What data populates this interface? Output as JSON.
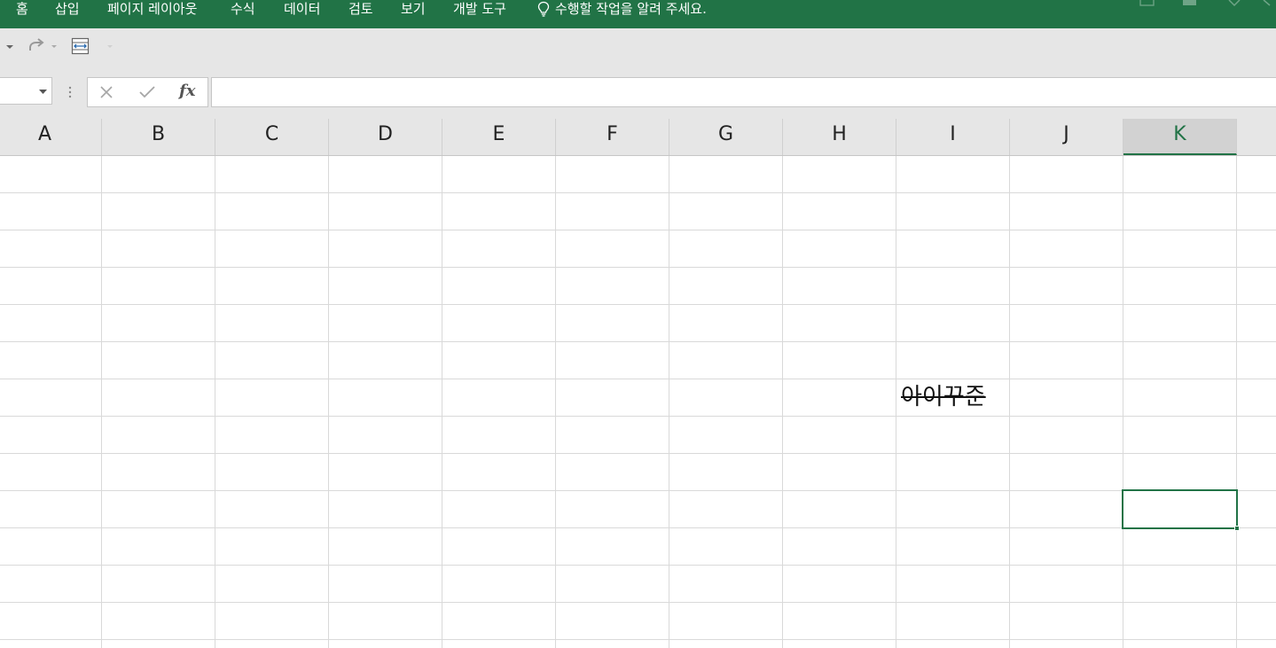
{
  "ribbon": {
    "tabs": [
      {
        "label": "홈"
      },
      {
        "label": "삽입"
      },
      {
        "label": "페이지 레이아웃"
      },
      {
        "label": "수식"
      },
      {
        "label": "데이터"
      },
      {
        "label": "검토"
      },
      {
        "label": "보기"
      },
      {
        "label": "개발 도구"
      }
    ],
    "tell_me": "수행할 작업을 알려 주세요.",
    "tell_me_icon": "lightbulb-icon",
    "background": "#217346"
  },
  "quick_access": {
    "icons": [
      "undo-dropdown-icon",
      "redo-icon",
      "redo-dropdown-icon",
      "fit-width-icon",
      "customize-dropdown-icon"
    ]
  },
  "formula_bar": {
    "name_box_value": "",
    "cancel_icon": "close-icon",
    "enter_icon": "check-icon",
    "function_icon": "fx-icon",
    "function_label": "fx",
    "formula_value": ""
  },
  "sheet": {
    "columns": [
      "A",
      "B",
      "C",
      "D",
      "E",
      "F",
      "G",
      "H",
      "I",
      "J",
      "K"
    ],
    "active_column": "K",
    "cells": [
      {
        "column": "I",
        "text": "아이꾸준",
        "strikethrough": true
      }
    ],
    "selection_color": "#217346"
  }
}
